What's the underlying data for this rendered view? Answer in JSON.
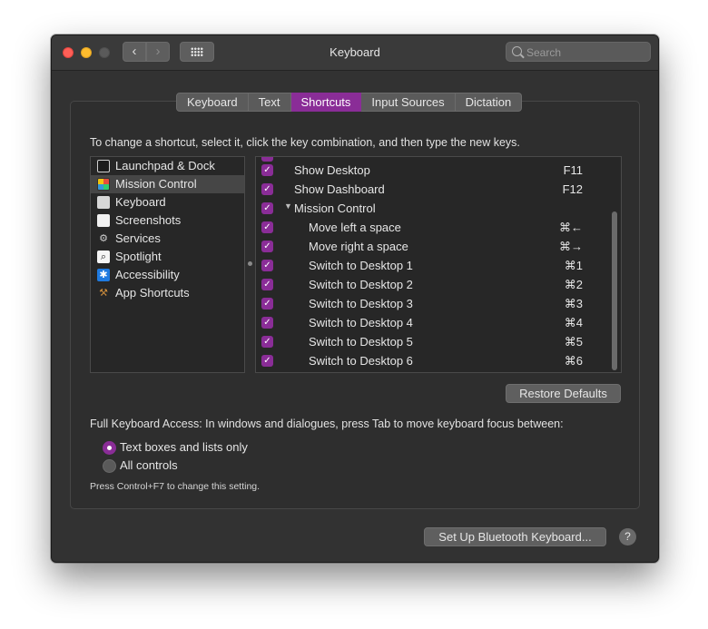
{
  "window": {
    "title": "Keyboard"
  },
  "search": {
    "placeholder": "Search"
  },
  "toolbar": {
    "back_icon": "chevron-left-icon",
    "forward_icon": "chevron-right-icon",
    "grid_icon": "grid-icon"
  },
  "tabs": [
    {
      "label": "Keyboard",
      "active": false
    },
    {
      "label": "Text",
      "active": false
    },
    {
      "label": "Shortcuts",
      "active": true
    },
    {
      "label": "Input Sources",
      "active": false
    },
    {
      "label": "Dictation",
      "active": false
    }
  ],
  "instructions": "To change a shortcut, select it, click the key combination, and then type the new keys.",
  "categories": [
    {
      "label": "Launchpad & Dock",
      "icon": "launchpad-icon"
    },
    {
      "label": "Mission Control",
      "icon": "mission-control-icon",
      "selected": true
    },
    {
      "label": "Keyboard",
      "icon": "keyboard-icon"
    },
    {
      "label": "Screenshots",
      "icon": "screenshots-icon"
    },
    {
      "label": "Services",
      "icon": "gear-icon"
    },
    {
      "label": "Spotlight",
      "icon": "spotlight-icon"
    },
    {
      "label": "Accessibility",
      "icon": "accessibility-icon"
    },
    {
      "label": "App Shortcuts",
      "icon": "app-shortcuts-icon"
    }
  ],
  "shortcuts": [
    {
      "name": "Show Desktop",
      "key": "F11",
      "checked": true
    },
    {
      "name": "Show Dashboard",
      "key": "F12",
      "checked": true
    },
    {
      "name": "Mission Control",
      "key": "",
      "checked": true,
      "group": true
    },
    {
      "name": "Move left a space",
      "key": "⌘←",
      "checked": true
    },
    {
      "name": "Move right a space",
      "key": "⌘→",
      "checked": true
    },
    {
      "name": "Switch to Desktop 1",
      "key": "⌘1",
      "checked": true
    },
    {
      "name": "Switch to Desktop 2",
      "key": "⌘2",
      "checked": true
    },
    {
      "name": "Switch to Desktop 3",
      "key": "⌘3",
      "checked": true
    },
    {
      "name": "Switch to Desktop 4",
      "key": "⌘4",
      "checked": true
    },
    {
      "name": "Switch to Desktop 5",
      "key": "⌘5",
      "checked": true
    },
    {
      "name": "Switch to Desktop 6",
      "key": "⌘6",
      "checked": true
    }
  ],
  "restore_defaults": "Restore Defaults",
  "full_keyboard_access": "Full Keyboard Access: In windows and dialogues, press Tab to move keyboard focus between:",
  "radio_options": [
    {
      "label": "Text boxes and lists only",
      "selected": true
    },
    {
      "label": "All controls",
      "selected": false
    }
  ],
  "hint": "Press Control+F7 to change this setting.",
  "bluetooth_button": "Set Up Bluetooth Keyboard...",
  "help_label": "?",
  "colors": {
    "accent": "#8a2d97",
    "window_bg": "#323232"
  }
}
